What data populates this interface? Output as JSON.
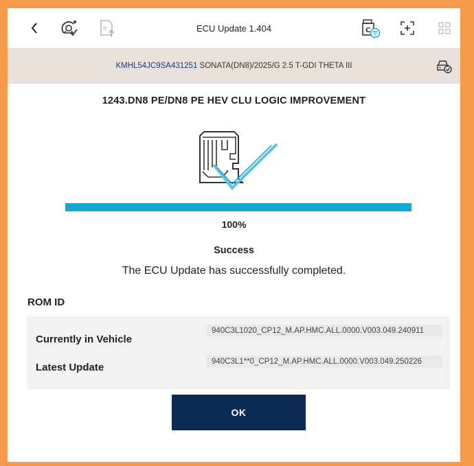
{
  "header": {
    "title": "ECU Update 1.404",
    "back_icon": "back-arrow-icon",
    "icons": [
      "vehicle-diagnostic-icon",
      "document-upload-icon",
      "vci-wireless-icon",
      "screen-capture-icon",
      "app-grid-icon"
    ]
  },
  "vehicle": {
    "vin": "KMHL54JC9SA431251",
    "description": "SONATA(DN8)/2025/G 2.5 T-GDI THETA III"
  },
  "update": {
    "title": "1243.DN8 PE/DN8 PE HEV CLU LOGIC IMPROVEMENT",
    "progress_percent": 100,
    "progress_text": "100%",
    "status": "Success",
    "message": "The ECU Update has successfully completed."
  },
  "rom": {
    "heading": "ROM ID",
    "rows": [
      {
        "label": "Currently in Vehicle",
        "value": "940C3L1020_CP12_M.AP.HMC.ALL.0000.V003.049.240911"
      },
      {
        "label": "Latest Update",
        "value": "940C3L1**0_CP12_M.AP.HMC.ALL.0000.V003.049.250226"
      }
    ]
  },
  "actions": {
    "ok_label": "OK"
  },
  "colors": {
    "background": "#f59a4a",
    "vin_bar": "#e8e1db",
    "progress": "#17a6cf",
    "primary_button": "#0d2b55",
    "vin_text": "#1b3e6e"
  }
}
